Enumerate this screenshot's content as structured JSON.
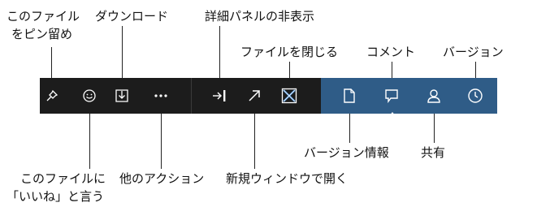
{
  "toolbar": {
    "pin": {
      "label": "このファイルをピン留め",
      "label_line1": "このファイル",
      "label_line2": "をピン留め",
      "icon": "pin-icon"
    },
    "like": {
      "label_line1": "このファイルに",
      "label_line2": "「いいね」と言う",
      "icon": "smiley-icon"
    },
    "download": {
      "label": "ダウンロード",
      "icon": "download-icon"
    },
    "more": {
      "label": "他のアクション",
      "icon": "more-icon"
    },
    "hide_details": {
      "label": "詳細パネルの非表示",
      "icon": "collapse-panel-icon"
    },
    "open_new_window": {
      "label": "新規ウィンドウで開く",
      "icon": "open-new-window-icon"
    },
    "close_file": {
      "label": "ファイルを閉じる",
      "icon": "close-icon"
    },
    "version_info": {
      "label": "バージョン情報",
      "icon": "document-icon"
    },
    "comment": {
      "label": "コメント",
      "icon": "comment-icon"
    },
    "share": {
      "label": "共有",
      "icon": "person-icon"
    },
    "version": {
      "label": "バージョン",
      "icon": "clock-icon"
    }
  },
  "colors": {
    "dark_bar": "#1c1c1c",
    "blue_bar": "#2f5c87",
    "icon": "#ffffff",
    "close_accent": "#4a90d9"
  }
}
